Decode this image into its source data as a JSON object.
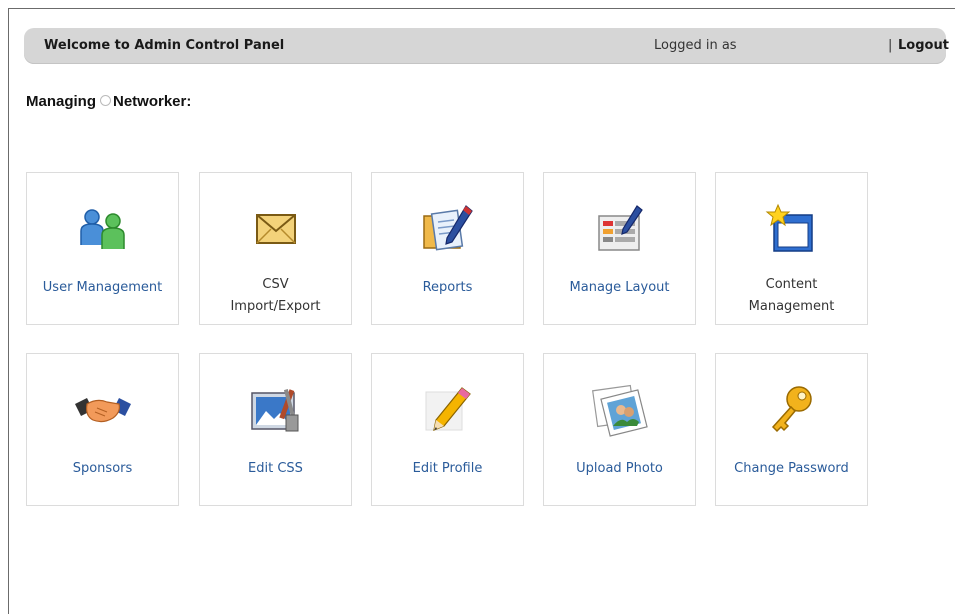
{
  "header": {
    "welcome": "Welcome to Admin Control Panel",
    "logged_in": "Logged in as",
    "separator": "|",
    "logout": "Logout"
  },
  "managing": {
    "prefix": "Managing",
    "name": "Networker:"
  },
  "tiles": [
    {
      "label": "User Management",
      "icon": "users-icon"
    },
    {
      "label_line1": "CSV",
      "label_line2": "Import/Export",
      "icon": "envelope-icon"
    },
    {
      "label": "Reports",
      "icon": "reports-icon"
    },
    {
      "label": "Manage Layout",
      "icon": "layout-icon"
    },
    {
      "label_line1": "Content",
      "label_line2": "Management",
      "icon": "content-folder-icon"
    },
    {
      "label": "Sponsors",
      "icon": "handshake-icon"
    },
    {
      "label": "Edit CSS",
      "icon": "edit-css-icon"
    },
    {
      "label": "Edit Profile",
      "icon": "pencil-icon"
    },
    {
      "label": "Upload Photo",
      "icon": "photo-icon"
    },
    {
      "label": "Change Password",
      "icon": "key-icon"
    }
  ],
  "colors": {
    "header_bg": "#d6d6d6",
    "tile_border": "#dcdcdc",
    "tile_label": "#2a5b9a"
  }
}
